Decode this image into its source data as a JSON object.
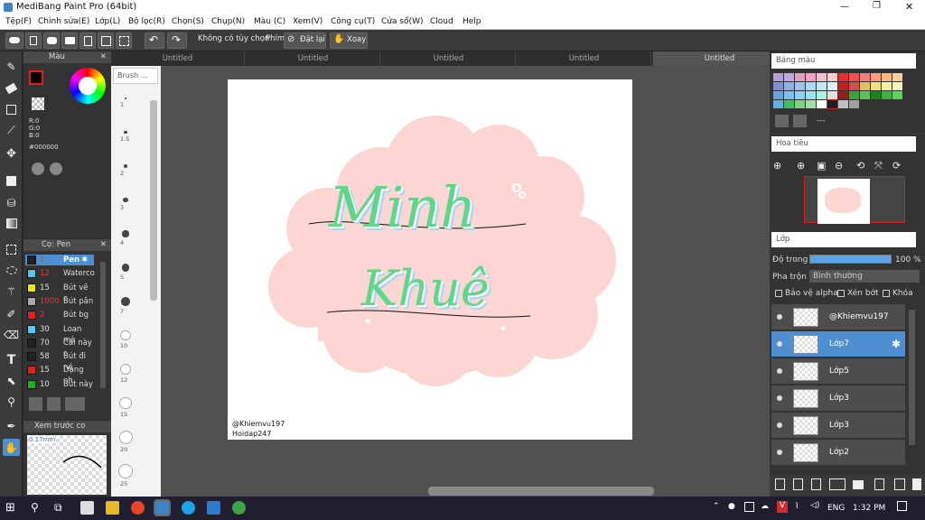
{
  "window": {
    "title": "MediBang Paint Pro (64bit)"
  },
  "menu": [
    "Tệp(F)",
    "Chỉnh sửa(E)",
    "Lớp(L)",
    "Bộ lọc(R)",
    "Chọn(S)",
    "Chụp(N)",
    "Màu (C)",
    "Xem(V)",
    "Công cụ(T)",
    "Cửa sổ(W)",
    "Cloud",
    "Help"
  ],
  "toolbar": {
    "snap_off": "Không có tùy chọn",
    "snap_label": "Phím",
    "reset": "Đặt lại",
    "rotate": "Xoay"
  },
  "tabs": [
    "Untitled",
    "Untitled",
    "Untitled",
    "Untitled",
    "Untitled"
  ],
  "color_panel": {
    "title": "Màu",
    "r": "R:0",
    "g": "G:0",
    "b": "B:0",
    "hex": "#000000"
  },
  "brush_panel": {
    "title": "Cọ: Pen",
    "items": [
      {
        "size": "2",
        "name": "Pen",
        "color": "#222222",
        "sel": true
      },
      {
        "size": "12",
        "name": "Waterco",
        "color": "#4cc8f0"
      },
      {
        "size": "15",
        "name": "Bút vẽ c",
        "color": "#f2e600"
      },
      {
        "size": "1000",
        "name": "Bút pân",
        "color": "#aaaaaa"
      },
      {
        "size": "2",
        "name": "Bút bg",
        "color": "#e02020"
      },
      {
        "size": "30",
        "name": "Loan mà",
        "color": "#4ad0f0"
      },
      {
        "size": "70",
        "name": "Cái này c",
        "color": "#222222"
      },
      {
        "size": "58",
        "name": "Bút đi né",
        "color": "#222222"
      },
      {
        "size": "15",
        "name": "Dạng nh",
        "color": "#e02020"
      },
      {
        "size": "10",
        "name": "Bút này",
        "color": "#20b020"
      }
    ]
  },
  "preview_panel": {
    "title": "Xem trước co",
    "size": "0.17mm"
  },
  "brush_sizes": [
    "1",
    "1.5",
    "2",
    "3",
    "4",
    "5",
    "7",
    "10",
    "12",
    "15",
    "20",
    "25"
  ],
  "brush_header": "Brush ...",
  "canvas": {
    "watermark1": "@Khiemvu197",
    "watermark2": "Hoidap247",
    "art_line1": "Minh",
    "art_line2": "Khuê"
  },
  "palette_panel": {
    "title": "Bảng màu",
    "add_label": "---"
  },
  "navigator": {
    "title": "Hoa tiêu"
  },
  "layers_panel": {
    "title": "Lớp",
    "opacity_label": "Độ trong",
    "opacity_value": "100 %",
    "blend_label": "Pha trộn",
    "blend_value": "Bình thường",
    "protect_alpha": "Bảo vệ alpha",
    "clip": "Xén bớt",
    "lock": "Khóa",
    "layers": [
      {
        "name": "@Khiemvu197"
      },
      {
        "name": "Lớp7",
        "sel": true
      },
      {
        "name": "Lớp5"
      },
      {
        "name": "Lớp3"
      },
      {
        "name": "Lớp3"
      },
      {
        "name": "Lớp2"
      }
    ]
  },
  "taskbar": {
    "lang": "ENG",
    "time": "1:32 PM"
  },
  "colors": {
    "accent": "#4d8fd0",
    "canvas_blob": "#fcd6d2",
    "letter_green": "#5fd68a",
    "letter_blue": "#a8d8f0"
  }
}
